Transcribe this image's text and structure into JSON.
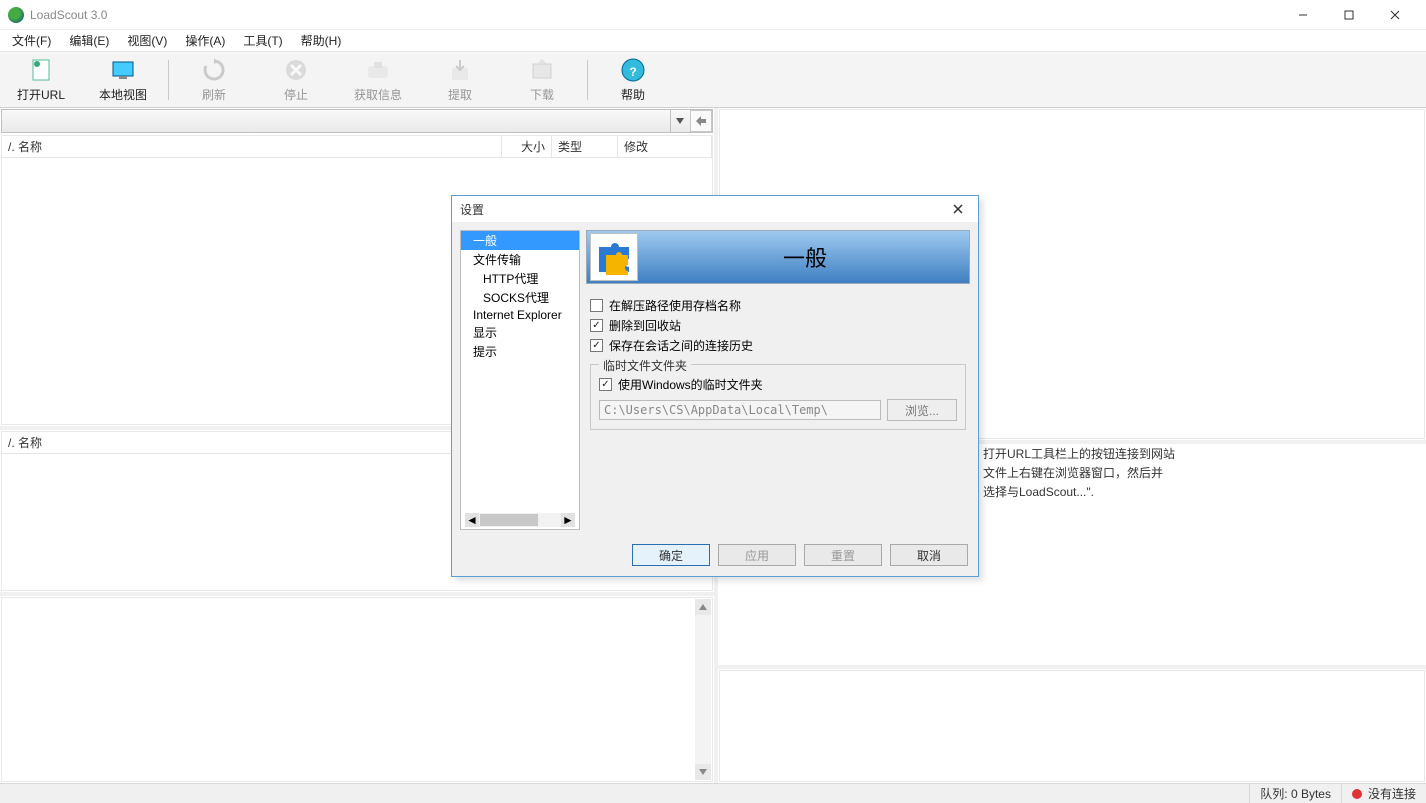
{
  "window": {
    "title": "LoadScout 3.0"
  },
  "menu": {
    "file": "文件(F)",
    "edit": "编辑(E)",
    "view": "视图(V)",
    "action": "操作(A)",
    "tools": "工具(T)",
    "help": "帮助(H)"
  },
  "toolbar": {
    "open_url": "打开URL",
    "local_view": "本地视图",
    "refresh": "刷新",
    "stop": "停止",
    "get_info": "获取信息",
    "extract": "提取",
    "download": "下载",
    "help": "帮助"
  },
  "columns": {
    "name": "/.  名称",
    "size": "大小",
    "type": "类型",
    "modified": "修改"
  },
  "lower_columns": {
    "name": "/.  名称"
  },
  "rightHelp": {
    "l1": "打开URL工具栏上的按钮连接到网站",
    "l2": "文件上右键在浏览器窗口，然后并",
    "l3": "选择与LoadScout...\"."
  },
  "status": {
    "queue": "队列: 0 Bytes",
    "conn": "没有连接"
  },
  "dialog": {
    "title": "设置",
    "tree": {
      "general": "一般",
      "file_transfer": "文件传输",
      "http_proxy": "HTTP代理",
      "socks_proxy": "SOCKS代理",
      "ie": "Internet Explorer",
      "display": "显示",
      "hint": "提示"
    },
    "banner": "一般",
    "opt_archive": "在解压路径使用存档名称",
    "opt_recycle": "删除到回收站",
    "opt_history": "保存在会话之间的连接历史",
    "group_label": "临时文件文件夹",
    "opt_wintemp": "使用Windows的临时文件夹",
    "temp_path": "C:\\Users\\CS\\AppData\\Local\\Temp\\",
    "browse": "浏览...",
    "ok": "确定",
    "apply": "应用",
    "reset": "重置",
    "cancel": "取消"
  }
}
